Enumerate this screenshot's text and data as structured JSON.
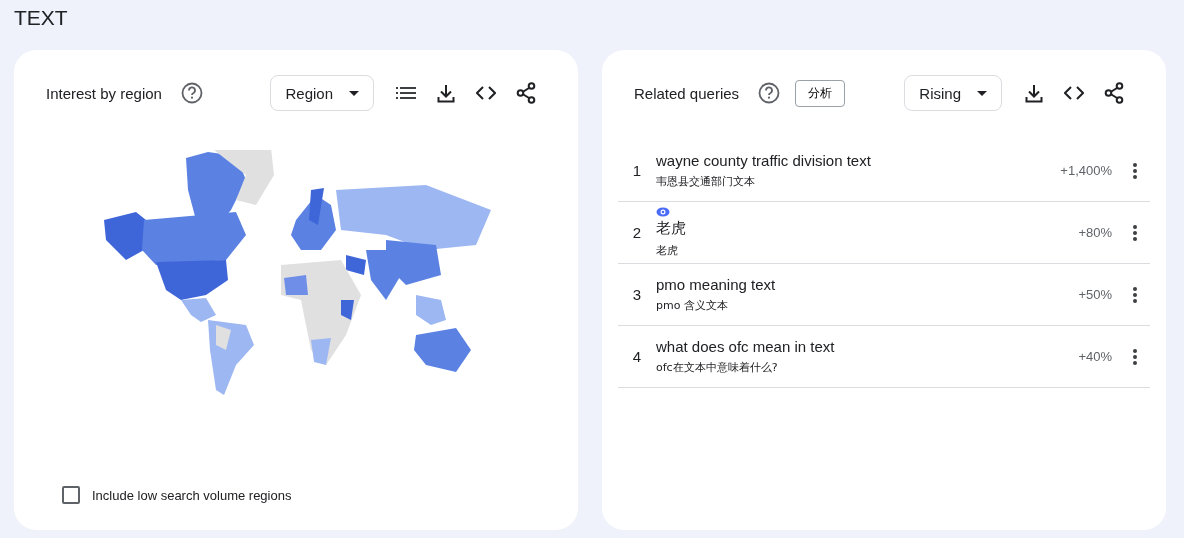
{
  "page_title": "TEXT",
  "region_card": {
    "title": "Interest by region",
    "dropdown": "Region",
    "checkbox": {
      "label": "Include low search volume regions",
      "checked": false
    }
  },
  "queries_card": {
    "title": "Related queries",
    "badge": "分析",
    "dropdown": "Rising",
    "rows": [
      {
        "rank": "1",
        "query": "wayne county traffic division text",
        "translation": "韦恩县交通部门文本",
        "value": "+1,400%",
        "flagged": false
      },
      {
        "rank": "2",
        "query": "老虎",
        "translation": "老虎",
        "value": "+80%",
        "flagged": true
      },
      {
        "rank": "3",
        "query": "pmo meaning text",
        "translation": "pmo 含义文本",
        "value": "+50%",
        "flagged": false
      },
      {
        "rank": "4",
        "query": "what does ofc mean in text",
        "translation": "ofc在文本中意味着什么?",
        "value": "+40%",
        "flagged": false
      }
    ]
  }
}
